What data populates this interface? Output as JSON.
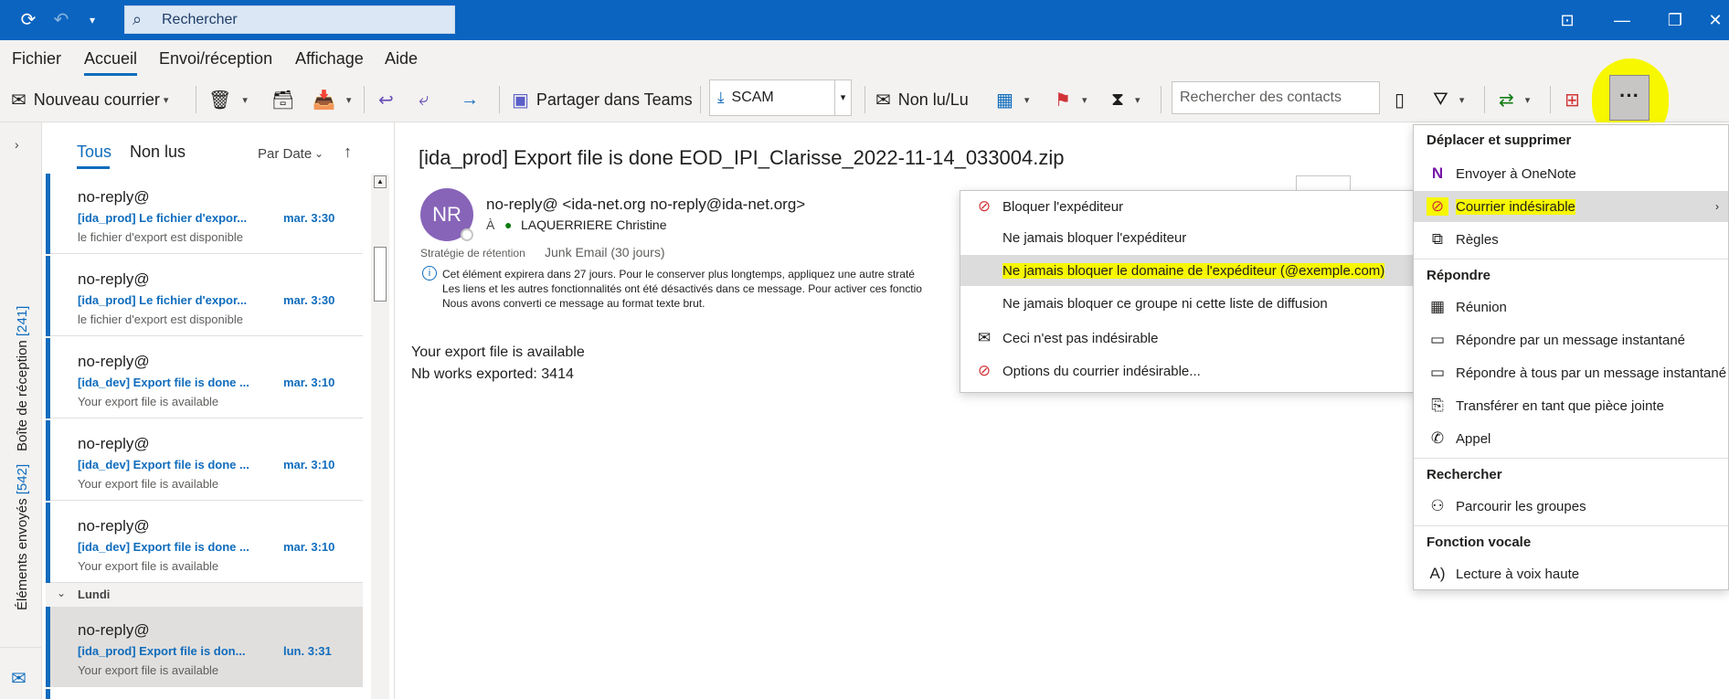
{
  "titlebar": {
    "search_placeholder": "Rechercher"
  },
  "menu_tabs": [
    "Fichier",
    "Accueil",
    "Envoi/réception",
    "Affichage",
    "Aide"
  ],
  "ribbon": {
    "new_mail": "Nouveau courrier",
    "share_teams": "Partager dans Teams",
    "move_to_value": "SCAM",
    "unread_read": "Non lu/Lu",
    "search_contacts_placeholder": "Rechercher des contacts"
  },
  "folders": {
    "inbox_label": "Boîte de réception",
    "inbox_count": "[241]",
    "sent_label": "Éléments envoyés",
    "sent_count": "[542]"
  },
  "list": {
    "filter_all": "Tous",
    "filter_unread": "Non lus",
    "sort": "Par Date",
    "group_monday": "Lundi",
    "messages": [
      {
        "from": "no-reply@",
        "subject": "[ida_prod] Le fichier d'expor...",
        "time": "mar. 3:30",
        "preview": "le fichier d'export est disponible"
      },
      {
        "from": "no-reply@",
        "subject": "[ida_prod] Le fichier d'expor...",
        "time": "mar. 3:30",
        "preview": "le fichier d'export est disponible"
      },
      {
        "from": "no-reply@",
        "subject": "[ida_dev] Export file is done ...",
        "time": "mar. 3:10",
        "preview": "Your export file is available"
      },
      {
        "from": "no-reply@",
        "subject": "[ida_dev] Export file is done ...",
        "time": "mar. 3:10",
        "preview": "Your export file is available"
      },
      {
        "from": "no-reply@",
        "subject": "[ida_dev] Export file is done ...",
        "time": "mar. 3:10",
        "preview": "Your export file is available"
      },
      {
        "from": "no-reply@",
        "subject": "[ida_prod] Export file is don...",
        "time": "lun. 3:31",
        "preview": "Your export file is available"
      }
    ]
  },
  "reading": {
    "subject": "[ida_prod] Export file is done EOD_IPI_Clarisse_2022-11-14_033004.zip",
    "avatar": "NR",
    "sender": "no-reply@ <ida-net.org no-reply@ida-net.org>",
    "to_label": "À",
    "to_name": "LAQUERRIERE Christine",
    "retention_label": "Stratégie de rétention",
    "retention_value": "Junk Email (30 jours)",
    "info_line1": "Cet élément expirera dans 27 jours. Pour le conserver plus longtemps, appliquez une autre straté",
    "info_line2": "Les liens et les autres fonctionnalités ont été désactivés dans ce message. Pour activer ces fonctio",
    "info_line3": "Nous avons converti ce message au format texte brut.",
    "body_line1": "Your export file is available",
    "body_line2": "Nb works exported: 3414"
  },
  "junk_menu": {
    "items": [
      "Bloquer l'expéditeur",
      "Ne jamais bloquer l'expéditeur",
      "Ne jamais bloquer le domaine de l'expéditeur (@exemple.com)",
      "Ne jamais bloquer ce groupe ni cette liste de diffusion",
      "Ceci n'est pas indésirable",
      "Options du courrier indésirable..."
    ]
  },
  "more_menu": {
    "section_move": "Déplacer et supprimer",
    "onenote": "Envoyer à OneNote",
    "junk": "Courrier indésirable",
    "rules": "Règles",
    "section_reply": "Répondre",
    "meeting": "Réunion",
    "reply_im": "Répondre par un message instantané",
    "reply_all_im": "Répondre à tous par un message instantané",
    "forward_attach": "Transférer en tant que pièce jointe",
    "call": "Appel",
    "section_search": "Rechercher",
    "browse_groups": "Parcourir les groupes",
    "section_voice": "Fonction vocale",
    "read_aloud": "Lecture à voix haute"
  },
  "colors": {
    "accent": "#0f6cbd",
    "titlebar": "#0b64c0",
    "annotation_highlight": "#f7f700"
  }
}
